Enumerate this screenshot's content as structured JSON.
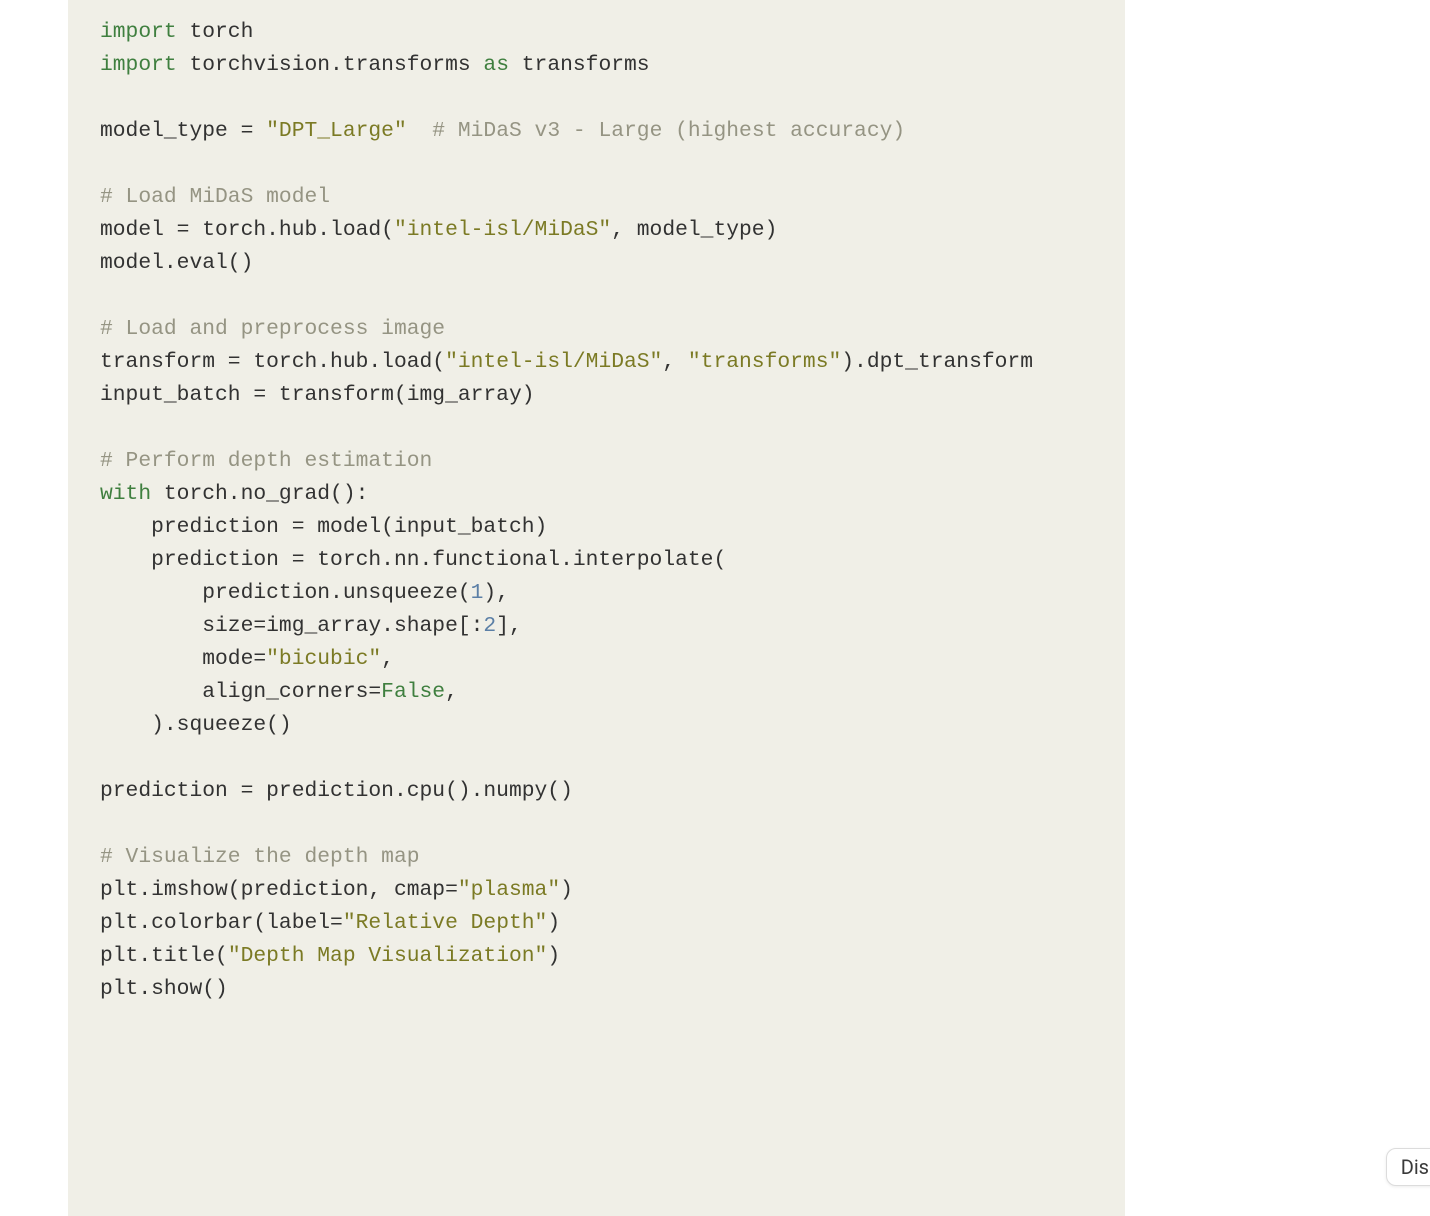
{
  "code": {
    "line01_import": "import",
    "line01_rest": " torch",
    "line02_import": "import",
    "line02_rest": " torchvision.transforms ",
    "line02_as": "as",
    "line02_rest2": " transforms",
    "blank": "",
    "line04_a": "model_type = ",
    "line04_s": "\"DPT_Large\"",
    "line04_c": "  # MiDaS v3 - Large (highest accuracy)",
    "line06_c": "# Load MiDaS model",
    "line07_a": "model = torch.hub.load(",
    "line07_s": "\"intel-isl/MiDaS\"",
    "line07_b": ", model_type)",
    "line08": "model.eval()",
    "line10_c": "# Load and preprocess image",
    "line11_a": "transform = torch.hub.load(",
    "line11_s1": "\"intel-isl/MiDaS\"",
    "line11_b": ", ",
    "line11_s2": "\"transforms\"",
    "line11_c2": ").dpt_transform",
    "line12": "input_batch = transform(img_array)",
    "line14_c": "# Perform depth estimation",
    "line15_w": "with",
    "line15_r": " torch.no_grad():",
    "line16": "    prediction = model(input_batch)",
    "line17": "    prediction = torch.nn.functional.interpolate(",
    "line18_a": "        prediction.unsqueeze(",
    "line18_n": "1",
    "line18_b": "),",
    "line19_a": "        size=img_array.shape[:",
    "line19_n": "2",
    "line19_b": "],",
    "line20_a": "        mode=",
    "line20_s": "\"bicubic\"",
    "line20_b": ",",
    "line21_a": "        align_corners=",
    "line21_k": "False",
    "line21_b": ",",
    "line22": "    ).squeeze()",
    "line24": "prediction = prediction.cpu().numpy()",
    "line26_c": "# Visualize the depth map",
    "line27_a": "plt.imshow(prediction, cmap=",
    "line27_s": "\"plasma\"",
    "line27_b": ")",
    "line28_a": "plt.colorbar(label=",
    "line28_s": "\"Relative Depth\"",
    "line28_b": ")",
    "line29_a": "plt.title(",
    "line29_s": "\"Depth Map Visualization\"",
    "line29_b": ")",
    "line30": "plt.show()"
  },
  "button": {
    "label": "Dis"
  }
}
